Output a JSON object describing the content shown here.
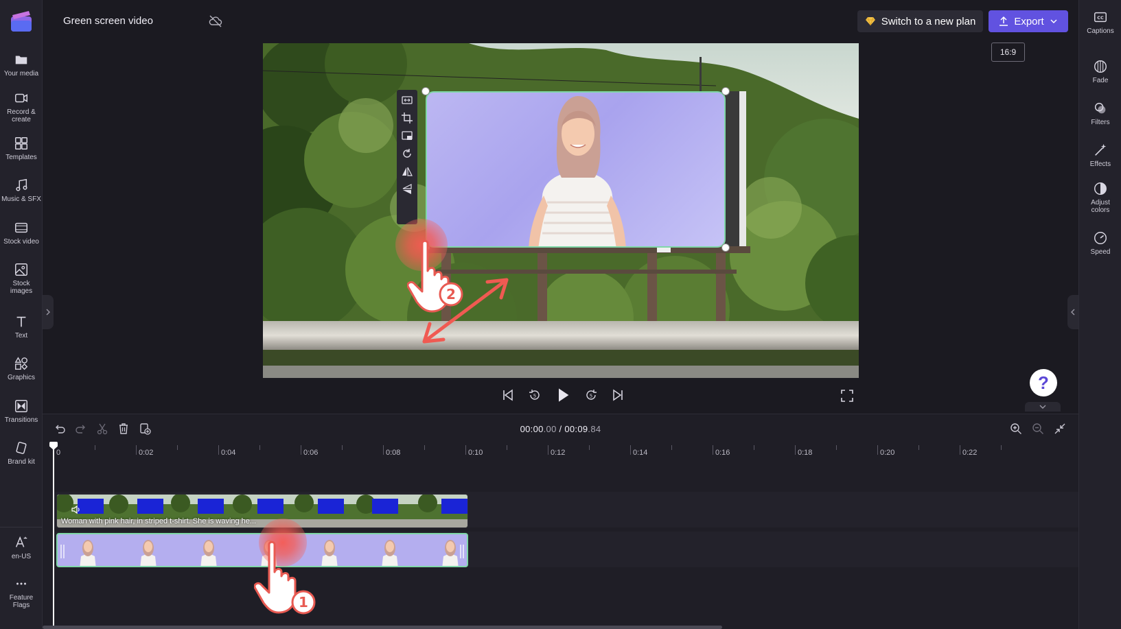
{
  "project": {
    "title": "Green screen video"
  },
  "header": {
    "plan_label": "Switch to a new plan",
    "export_label": "Export",
    "aspect_ratio": "16:9"
  },
  "left_sidebar": {
    "items": [
      {
        "label": "Your media"
      },
      {
        "label": "Record &\ncreate"
      },
      {
        "label": "Templates"
      },
      {
        "label": "Music & SFX"
      },
      {
        "label": "Stock video"
      },
      {
        "label": "Stock\nimages"
      },
      {
        "label": "Text"
      },
      {
        "label": "Graphics"
      },
      {
        "label": "Transitions"
      },
      {
        "label": "Brand kit"
      }
    ],
    "bottom_items": [
      {
        "label": "en-US"
      },
      {
        "label": "Feature\nFlags"
      }
    ]
  },
  "right_sidebar": {
    "items": [
      {
        "label": "Captions"
      },
      {
        "label": "Fade"
      },
      {
        "label": "Filters"
      },
      {
        "label": "Effects"
      },
      {
        "label": "Adjust\ncolors"
      },
      {
        "label": "Speed"
      }
    ]
  },
  "playback": {
    "current_time": "00:00",
    "current_ms": ".00",
    "separator": " / ",
    "total_time": "00:09",
    "total_ms": ".84"
  },
  "help": {
    "label": "?"
  },
  "timeline": {
    "ruler_labels": [
      "0",
      "0:02",
      "0:04",
      "0:06",
      "0:08",
      "0:10",
      "0:12",
      "0:14",
      "0:16",
      "0:18",
      "0:20",
      "0:22"
    ],
    "background_clip_caption": "Woman with pink hair, in striped t-shirt. She is waving he..."
  },
  "annotations": {
    "step_1": "1",
    "step_2": "2"
  },
  "colors": {
    "accent": "#6152e0",
    "selection": "#7fd7a7",
    "chroma_blue": "#1a24d6",
    "tap_marker": "#f65a52"
  }
}
